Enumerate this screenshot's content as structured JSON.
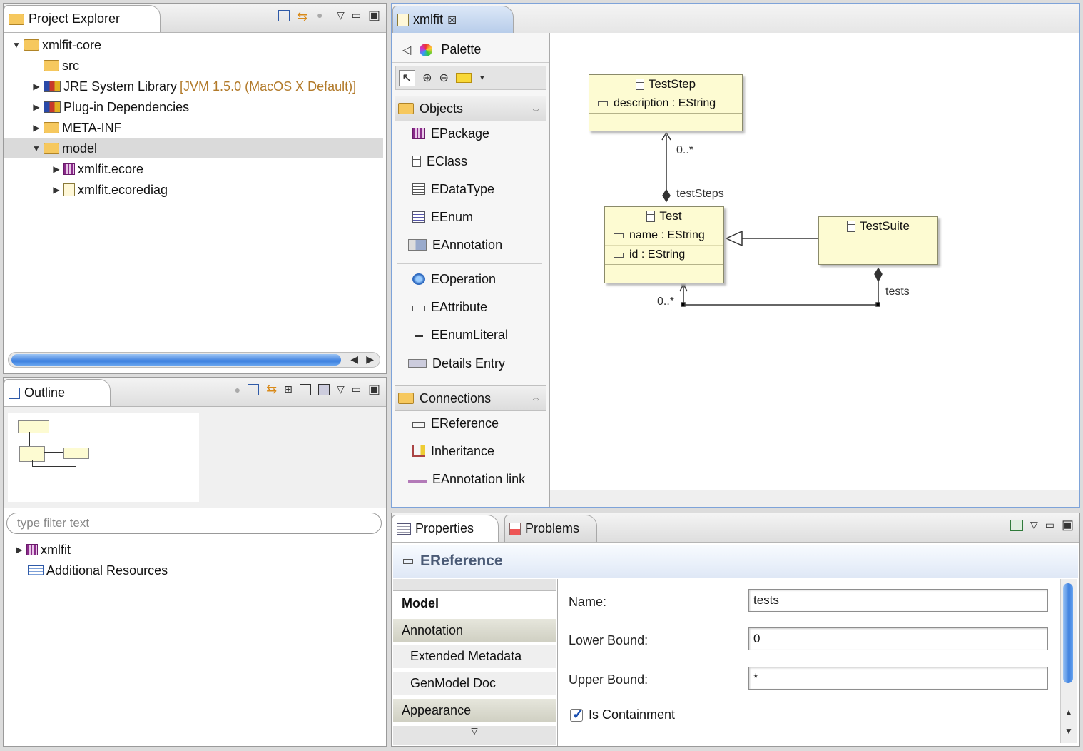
{
  "project_explorer": {
    "title": "Project Explorer",
    "tree": [
      {
        "label": "xmlfit-core",
        "suffix": ""
      },
      {
        "label": "src",
        "suffix": ""
      },
      {
        "label": "JRE System Library",
        "suffix": "[JVM 1.5.0 (MacOS X Default)]"
      },
      {
        "label": "Plug-in Dependencies",
        "suffix": ""
      },
      {
        "label": "META-INF",
        "suffix": ""
      },
      {
        "label": "model",
        "suffix": ""
      },
      {
        "label": "xmlfit.ecore",
        "suffix": ""
      },
      {
        "label": "xmlfit.ecorediag",
        "suffix": ""
      }
    ]
  },
  "outline": {
    "title": "Outline",
    "filter_placeholder": "type filter text",
    "tree": [
      {
        "label": "xmlfit"
      },
      {
        "label": "Additional Resources"
      }
    ]
  },
  "editor": {
    "tab_title": "xmlfit",
    "palette": {
      "title": "Palette",
      "objects_drawer": "Objects",
      "objects": [
        "EPackage",
        "EClass",
        "EDataType",
        "EEnum",
        "EAnnotation",
        "EOperation",
        "EAttribute",
        "EEnumLiteral",
        "Details Entry"
      ],
      "connections_drawer": "Connections",
      "connections": [
        "EReference",
        "Inheritance",
        "EAnnotation link"
      ]
    },
    "diagram": {
      "classes": [
        {
          "name": "TestStep",
          "attributes": [
            "description : EString"
          ]
        },
        {
          "name": "Test",
          "attributes": [
            "name : EString",
            "id : EString"
          ]
        },
        {
          "name": "TestSuite",
          "attributes": []
        }
      ],
      "labels": {
        "teststep_mult": "0..*",
        "teststeps_role": "testSteps",
        "tests_mult": "0..*",
        "tests_role": "tests"
      }
    }
  },
  "properties": {
    "tabs": [
      "Properties",
      "Problems"
    ],
    "header": "EReference",
    "side_tabs": [
      "Model",
      "Annotation",
      "Extended Metadata",
      "GenModel Doc",
      "Appearance"
    ],
    "fields": [
      {
        "label": "Name:",
        "value": "tests"
      },
      {
        "label": "Lower Bound:",
        "value": "0"
      },
      {
        "label": "Upper Bound:",
        "value": "*"
      }
    ],
    "checkbox": {
      "label": "Is Containment",
      "checked": true
    }
  },
  "colors": {
    "selection_blue": "#3d80df",
    "class_fill": "#fdfbd2",
    "active_tab": "#b8cdea"
  }
}
